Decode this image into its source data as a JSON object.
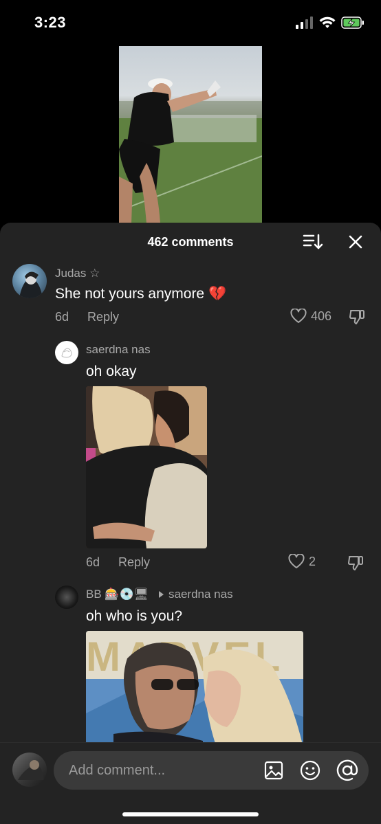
{
  "status": {
    "time": "3:23"
  },
  "sheet": {
    "title": "462 comments"
  },
  "comments": [
    {
      "user": "Judas ☆",
      "text": "She not yours anymore 💔",
      "age": "6d",
      "reply_label": "Reply",
      "likes": "406"
    },
    {
      "user": "saerdna nas",
      "text": "oh okay",
      "age": "6d",
      "reply_label": "Reply",
      "likes": "2"
    },
    {
      "user": "BB 🎰💿🖥",
      "reply_to": "saerdna nas",
      "text": "oh who is you?",
      "photo_sign": "MARVEL"
    }
  ],
  "composer": {
    "placeholder": "Add comment..."
  },
  "icons": [
    "signal-icon",
    "wifi-icon",
    "battery-charging-icon",
    "sort-icon",
    "close-icon",
    "heart-icon",
    "dislike-icon",
    "image-icon",
    "emoji-icon",
    "mention-icon"
  ],
  "colors": {
    "sheet_bg": "#232323",
    "muted_text": "#a8a8a8",
    "battery_green": "#5fc95c"
  }
}
